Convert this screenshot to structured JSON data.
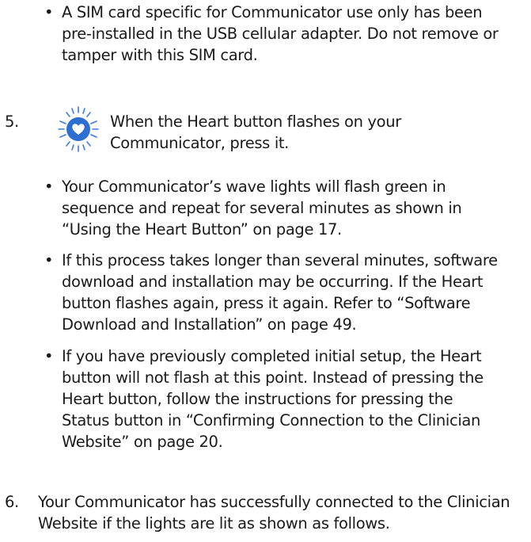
{
  "bullet_top": {
    "marker": "•",
    "text": "A SIM card specific for Communicator use only has been pre-installed in the USB cellular adapter. Do not remove or tamper with this SIM card."
  },
  "step5": {
    "number": "5.",
    "text": "When the Heart button flashes on your Communicator, press it.",
    "icon": "heart-button-icon",
    "icon_color": "#2c6fd1",
    "bullets": [
      {
        "marker": "•",
        "text": "Your Communicator’s wave lights will flash green in sequence and repeat for several minutes as shown in “Using the Heart Button” on page 17."
      },
      {
        "marker": "•",
        "text": "If this process takes longer than several minutes, software download and installation may be occurring. If the Heart button flashes again, press it again. Refer to “Software Download and Installation” on page 49."
      },
      {
        "marker": "•",
        "text": "If you have previously completed initial setup, the Heart button will not flash at this point. Instead of pressing the Heart button, follow the instructions for pressing the Status button in “Confirming Connection to the Clinician Website” on page 20."
      }
    ]
  },
  "step6": {
    "number": "6.",
    "text": "Your Communicator has successfully connected to the Clinician Website if the lights are lit as shown as follows."
  }
}
